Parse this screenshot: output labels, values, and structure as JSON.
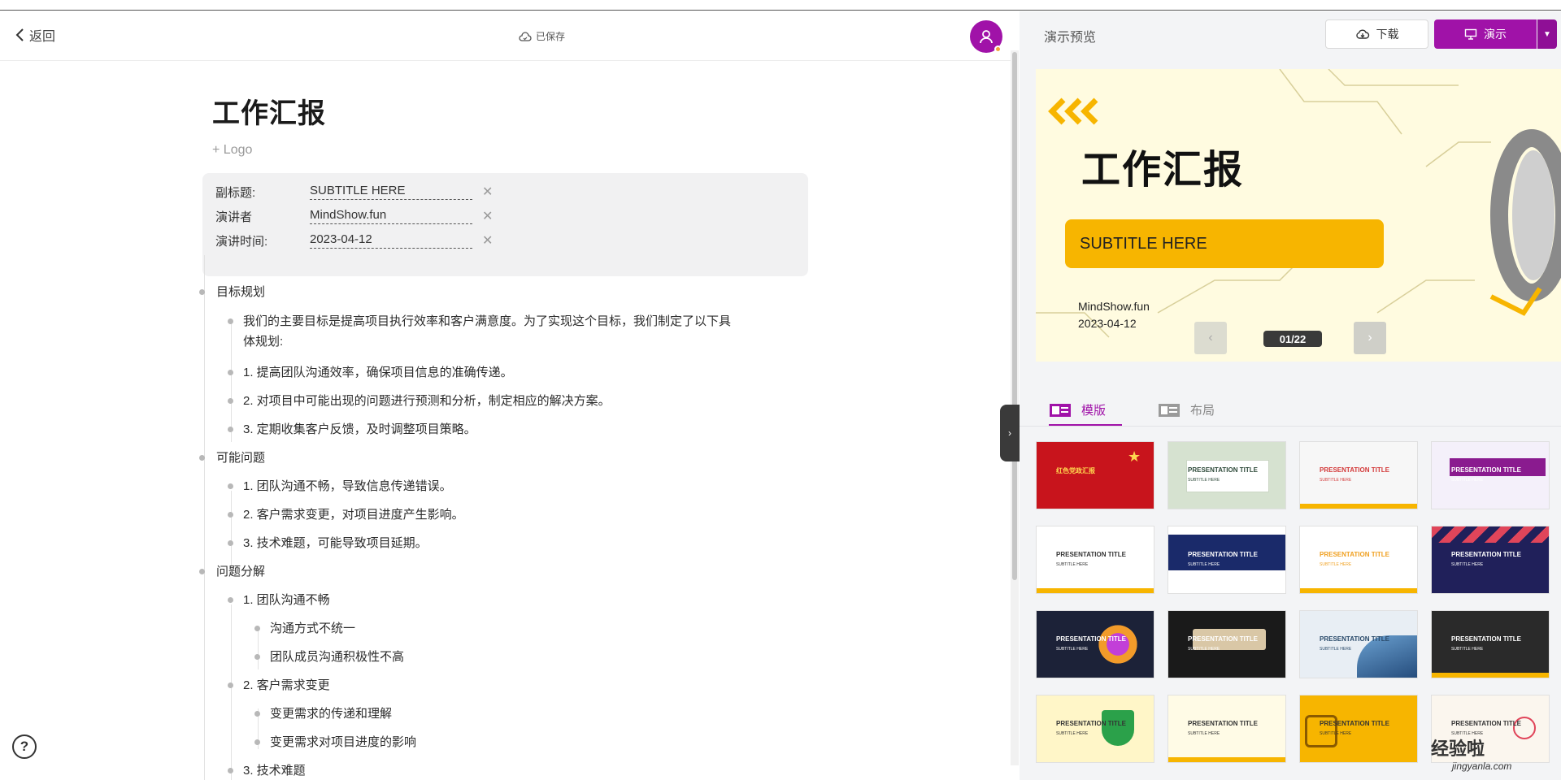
{
  "header": {
    "back_label": "返回",
    "saved_label": "已保存"
  },
  "document": {
    "title": "工作汇报",
    "logo_add": "+ Logo",
    "meta": [
      {
        "label": "副标题:",
        "value": "SUBTITLE HERE"
      },
      {
        "label": "演讲者",
        "value": "MindShow.fun"
      },
      {
        "label": "演讲时间:",
        "value": "2023-04-12"
      }
    ],
    "outline": [
      {
        "level": 0,
        "text": "目标规划"
      },
      {
        "level": 1,
        "text": "我们的主要目标是提高项目执行效率和客户满意度。为了实现这个目标，我们制定了以下具"
      },
      {
        "level": 1,
        "text": "体规划:",
        "continuation": true
      },
      {
        "level": 1,
        "text": "1. 提高团队沟通效率，确保项目信息的准确传递。"
      },
      {
        "level": 1,
        "text": "2. 对项目中可能出现的问题进行预测和分析，制定相应的解决方案。"
      },
      {
        "level": 1,
        "text": "3. 定期收集客户反馈，及时调整项目策略。"
      },
      {
        "level": 0,
        "text": "可能问题"
      },
      {
        "level": 1,
        "text": "1. 团队沟通不畅，导致信息传递错误。"
      },
      {
        "level": 1,
        "text": "2. 客户需求变更，对项目进度产生影响。"
      },
      {
        "level": 1,
        "text": "3. 技术难题，可能导致项目延期。"
      },
      {
        "level": 0,
        "text": "问题分解"
      },
      {
        "level": 1,
        "text": "1. 团队沟通不畅"
      },
      {
        "level": 2,
        "text": "沟通方式不统一"
      },
      {
        "level": 2,
        "text": "团队成员沟通积极性不高"
      },
      {
        "level": 1,
        "text": "2. 客户需求变更"
      },
      {
        "level": 2,
        "text": "变更需求的传递和理解"
      },
      {
        "level": 2,
        "text": "变更需求对项目进度的影响"
      },
      {
        "level": 1,
        "text": "3. 技术难题"
      }
    ]
  },
  "preview": {
    "label": "演示预览",
    "download_label": "下载",
    "present_label": "演示",
    "slide": {
      "title": "工作汇报",
      "subtitle": "SUBTITLE HERE",
      "presenter": "MindShow.fun",
      "date": "2023-04-12",
      "counter": "01/22"
    },
    "tabs": {
      "template": "模版",
      "layout": "布局"
    },
    "templates": [
      {
        "title": "红色党政汇报",
        "sub": "",
        "bg": "#c8141c",
        "fg": "#ffd54f"
      },
      {
        "title": "PRESENTATION TITLE",
        "sub": "SUBTITLE HERE",
        "bg": "#d6e2d0",
        "fg": "#2e4a3a"
      },
      {
        "title": "PRESENTATION TITLE",
        "sub": "SUBTITLE HERE",
        "bg": "#f7f7f7",
        "fg": "#d33a3a"
      },
      {
        "title": "PRESENTATION TITLE",
        "sub": "SUBTITLE HERE",
        "bg": "#f4f0fa",
        "fg": "#ffffff"
      },
      {
        "title": "PRESENTATION TITLE",
        "sub": "SUBTITLE HERE",
        "bg": "#ffffff",
        "fg": "#333333"
      },
      {
        "title": "PRESENTATION TITLE",
        "sub": "SUBTITLE HERE",
        "bg": "#ffffff",
        "fg": "#ffffff"
      },
      {
        "title": "PRESENTATION TITLE",
        "sub": "SUBTITLE HERE",
        "bg": "#ffffff",
        "fg": "#f0a020"
      },
      {
        "title": "PRESENTATION TITLE",
        "sub": "SUBTITLE HERE",
        "bg": "#20205a",
        "fg": "#ffffff"
      },
      {
        "title": "PRESENTATION TITLE",
        "sub": "SUBTITLE HERE",
        "bg": "#1c2238",
        "fg": "#ffffff"
      },
      {
        "title": "PRESENTATION TITLE",
        "sub": "SUBTITLE HERE",
        "bg": "#1a1a1a",
        "fg": "#ffffff"
      },
      {
        "title": "PRESENTATION TITLE",
        "sub": "SUBTITLE HERE",
        "bg": "#e8eef4",
        "fg": "#2a4a6a"
      },
      {
        "title": "PRESENTATION TITLE",
        "sub": "SUBTITLE HERE",
        "bg": "#2a2a2a",
        "fg": "#ffffff"
      },
      {
        "title": "PRESENTATION TITLE",
        "sub": "SUBTITLE HERE",
        "bg": "#fff6c8",
        "fg": "#333333"
      },
      {
        "title": "PRESENTATION TITLE",
        "sub": "SUBTITLE HERE",
        "bg": "#fffbe6",
        "fg": "#333333"
      },
      {
        "title": "PRESENTATION TITLE",
        "sub": "SUBTITLE HERE",
        "bg": "#f7b500",
        "fg": "#333333"
      },
      {
        "title": "PRESENTATION TITLE",
        "sub": "SUBTITLE HERE",
        "bg": "#fbf6ee",
        "fg": "#333333"
      }
    ]
  },
  "watermark": {
    "text": "经验啦",
    "sub": "jingyanla.com"
  },
  "colors": {
    "accent": "#a012a8",
    "slide_bg": "#fffbe0",
    "slide_subtitle_bg": "#f7b500"
  }
}
